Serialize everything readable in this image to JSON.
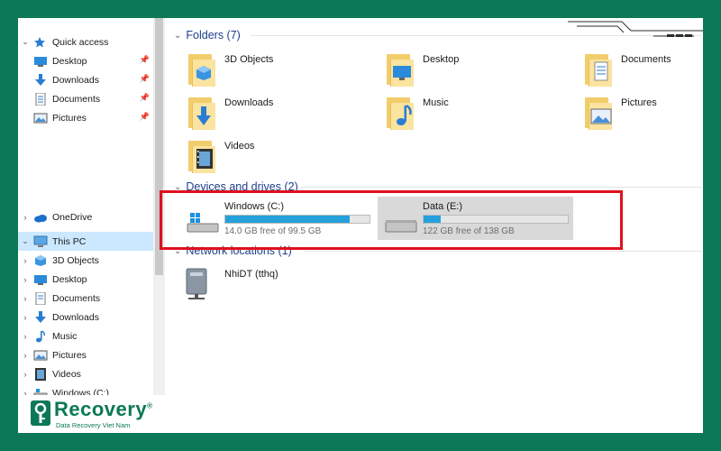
{
  "sidebar": {
    "quick_access": {
      "label": "Quick access",
      "items": [
        {
          "label": "Desktop"
        },
        {
          "label": "Downloads"
        },
        {
          "label": "Documents"
        },
        {
          "label": "Pictures"
        }
      ]
    },
    "onedrive": {
      "label": "OneDrive"
    },
    "this_pc": {
      "label": "This PC",
      "children": [
        {
          "label": "3D Objects"
        },
        {
          "label": "Desktop"
        },
        {
          "label": "Documents"
        },
        {
          "label": "Downloads"
        },
        {
          "label": "Music"
        },
        {
          "label": "Pictures"
        },
        {
          "label": "Videos"
        },
        {
          "label": "Windows (C:)"
        }
      ]
    }
  },
  "content": {
    "folders_header": "Folders (7)",
    "folders": [
      {
        "label": "3D Objects"
      },
      {
        "label": "Desktop"
      },
      {
        "label": "Documents"
      },
      {
        "label": "Downloads"
      },
      {
        "label": "Music"
      },
      {
        "label": "Pictures"
      },
      {
        "label": "Videos"
      }
    ],
    "devices_header": "Devices and drives (2)",
    "drives": [
      {
        "name": "Windows (C:)",
        "free": "14.0 GB free of 99.5 GB",
        "used_fraction": 0.86
      },
      {
        "name": "Data (E:)",
        "free": "122 GB free of 138 GB",
        "used_fraction": 0.12
      }
    ],
    "network_header": "Network locations (1)",
    "network": [
      {
        "label": "NhiDT (tthq)"
      }
    ]
  },
  "branding": {
    "name": "Recovery",
    "reg": "®",
    "tagline": "Data Recovery Viet Nam"
  },
  "colors": {
    "background": "#0c7856",
    "accent": "#26a0da",
    "highlight": "#e0101e",
    "selection": "#cce8ff"
  }
}
